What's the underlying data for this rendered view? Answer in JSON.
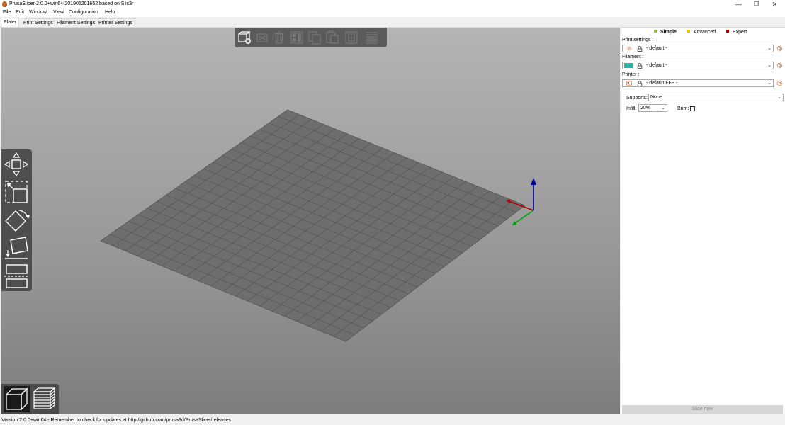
{
  "window": {
    "title": "PrusaSlicer-2.0.0+win64-201905201652 based on Slic3r",
    "minimize": "—",
    "maximize": "❐",
    "close": "✕"
  },
  "menu": [
    "File",
    "Edit",
    "Window",
    "View",
    "Configuration",
    "Help"
  ],
  "tabs": [
    "Plater",
    "Print Settings",
    "Filament Settings",
    "Printer Settings"
  ],
  "active_tab": "Plater",
  "mode": {
    "simple": "Simple",
    "advanced": "Advanced",
    "expert": "Expert",
    "selected": "Simple",
    "colors": {
      "simple": "#8cc43c",
      "advanced": "#f0c800",
      "expert": "#d40000"
    }
  },
  "sidebar": {
    "print_settings_label": "Print settings :",
    "print_settings_value": "- default -",
    "filament_label": "Filament :",
    "filament_value": "- default -",
    "filament_color": "#29b2a6",
    "printer_label": "Printer :",
    "printer_value": "- default FFF -",
    "supports_label": "Supports:",
    "supports_value": "None",
    "infill_label": "Infill:",
    "infill_value": "20%",
    "brim_label": "Brim:",
    "brim_checked": false,
    "slice_button": "Slice now"
  },
  "toolbar_icons": [
    "add-icon",
    "delete-icon",
    "delete-all-icon",
    "arrange-icon",
    "copy-icon",
    "paste-icon",
    "instances-icon",
    "split-icon"
  ],
  "gizmo_icons": [
    "move-icon",
    "scale-icon",
    "rotate-icon",
    "place-on-face-icon",
    "cut-icon"
  ],
  "view_icons": [
    "3d-view-icon",
    "preview-layers-icon"
  ],
  "axis_colors": {
    "x": "#b40000",
    "y": "#00a000",
    "z": "#000096"
  },
  "status": "Version 2.0.0+win64 - Remember to check for updates at http://github.com/prusa3d/PrusaSlicer/releases"
}
